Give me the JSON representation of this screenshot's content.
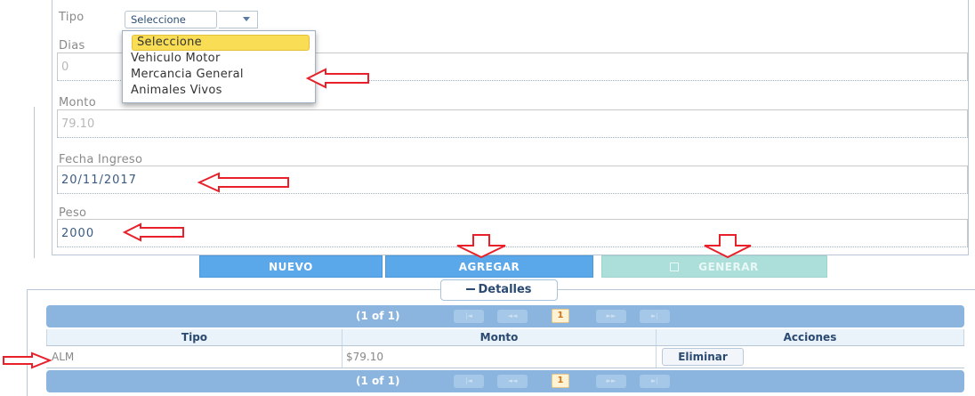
{
  "form": {
    "tipo_label": "Tipo",
    "tipo_selected": "Seleccione",
    "tipo_options": [
      "Seleccione",
      "Vehiculo Motor",
      "Mercancia General",
      "Animales Vivos"
    ],
    "dias_label": "Dias",
    "dias_value": "0",
    "monto_label": "Monto",
    "monto_value": "79.10",
    "fecha_label": "Fecha Ingreso",
    "fecha_value": "20/11/2017",
    "peso_label": "Peso",
    "peso_value": "2000"
  },
  "actions": {
    "nuevo": "NUEVO",
    "agregar": "AGREGAR",
    "generar": "GENERAR"
  },
  "detalles": {
    "title": "Detalles",
    "paginator": {
      "page_info": "(1 of 1)",
      "current_page": "1"
    },
    "columns": [
      "Tipo",
      "Monto",
      "Acciones"
    ],
    "rows": [
      {
        "tipo": "ALM",
        "monto": "$79.10",
        "action": "Eliminar"
      }
    ]
  },
  "colors": {
    "accent_blue": "#5aa7ea",
    "disabled_teal": "#acdfd9",
    "annotation_red": "#e8202a",
    "highlight_yellow": "#f9dd55"
  }
}
